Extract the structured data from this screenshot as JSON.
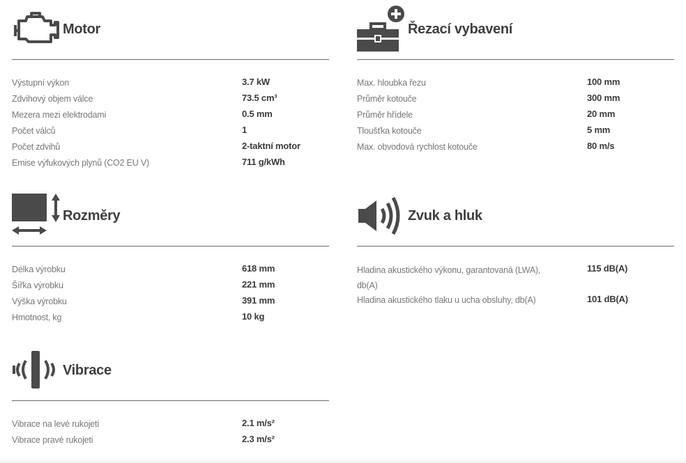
{
  "motor": {
    "title": "Motor",
    "icon": "engine-icon",
    "rows": [
      {
        "label": "Výstupní výkon",
        "value": "3.7 kW"
      },
      {
        "label": "Zdvihový objem válce",
        "value": "73.5 cm³"
      },
      {
        "label": "Mezera mezi elektrodami",
        "value": "0.5 mm"
      },
      {
        "label": "Počet válců",
        "value": "1"
      },
      {
        "label": "Počet zdvihů",
        "value": "2-taktní motor"
      },
      {
        "label": "Emise výfukových plynů (CO2 EU V)",
        "value": "711 g/kWh"
      }
    ]
  },
  "cutting": {
    "title": "Řezací vybavení",
    "icon": "toolbox-plus-icon",
    "rows": [
      {
        "label": "Max. hloubka řezu",
        "value": "100 mm"
      },
      {
        "label": "Průměr kotouče",
        "value": "300 mm"
      },
      {
        "label": "Průměr hřídele",
        "value": "20 mm"
      },
      {
        "label": "Tloušťka kotouče",
        "value": "5 mm"
      },
      {
        "label": "Max. obvodová rychlost kotouče",
        "value": "80 m/s"
      }
    ]
  },
  "dimensions": {
    "title": "Rozměry",
    "icon": "dimensions-icon",
    "rows": [
      {
        "label": "Délka výrobku",
        "value": "618 mm"
      },
      {
        "label": "Šířka výrobku",
        "value": "221 mm"
      },
      {
        "label": "Výška výrobku",
        "value": "391 mm"
      },
      {
        "label": "Hmotnost, kg",
        "value": "10 kg"
      }
    ]
  },
  "sound": {
    "title": "Zvuk a hluk",
    "icon": "speaker-icon",
    "rows": [
      {
        "label": "Hladina akustického výkonu, garantovaná (LWA), db(A)",
        "value": "115 dB(A)"
      },
      {
        "label": "Hladina akustického tlaku u ucha obsluhy, db(A)",
        "value": "101 dB(A)"
      }
    ]
  },
  "vibration": {
    "title": "Vibrace",
    "icon": "vibration-icon",
    "rows": [
      {
        "label": "Vibrace na levé rukojeti",
        "value": "2.1 m/s²"
      },
      {
        "label": "Vibrace pravé rukojeti",
        "value": "2.3 m/s²"
      }
    ]
  },
  "colors": {
    "icon": "#4a4a4a",
    "rule": "#6a6a6a",
    "label": "#777777",
    "value": "#3a3a3a"
  }
}
